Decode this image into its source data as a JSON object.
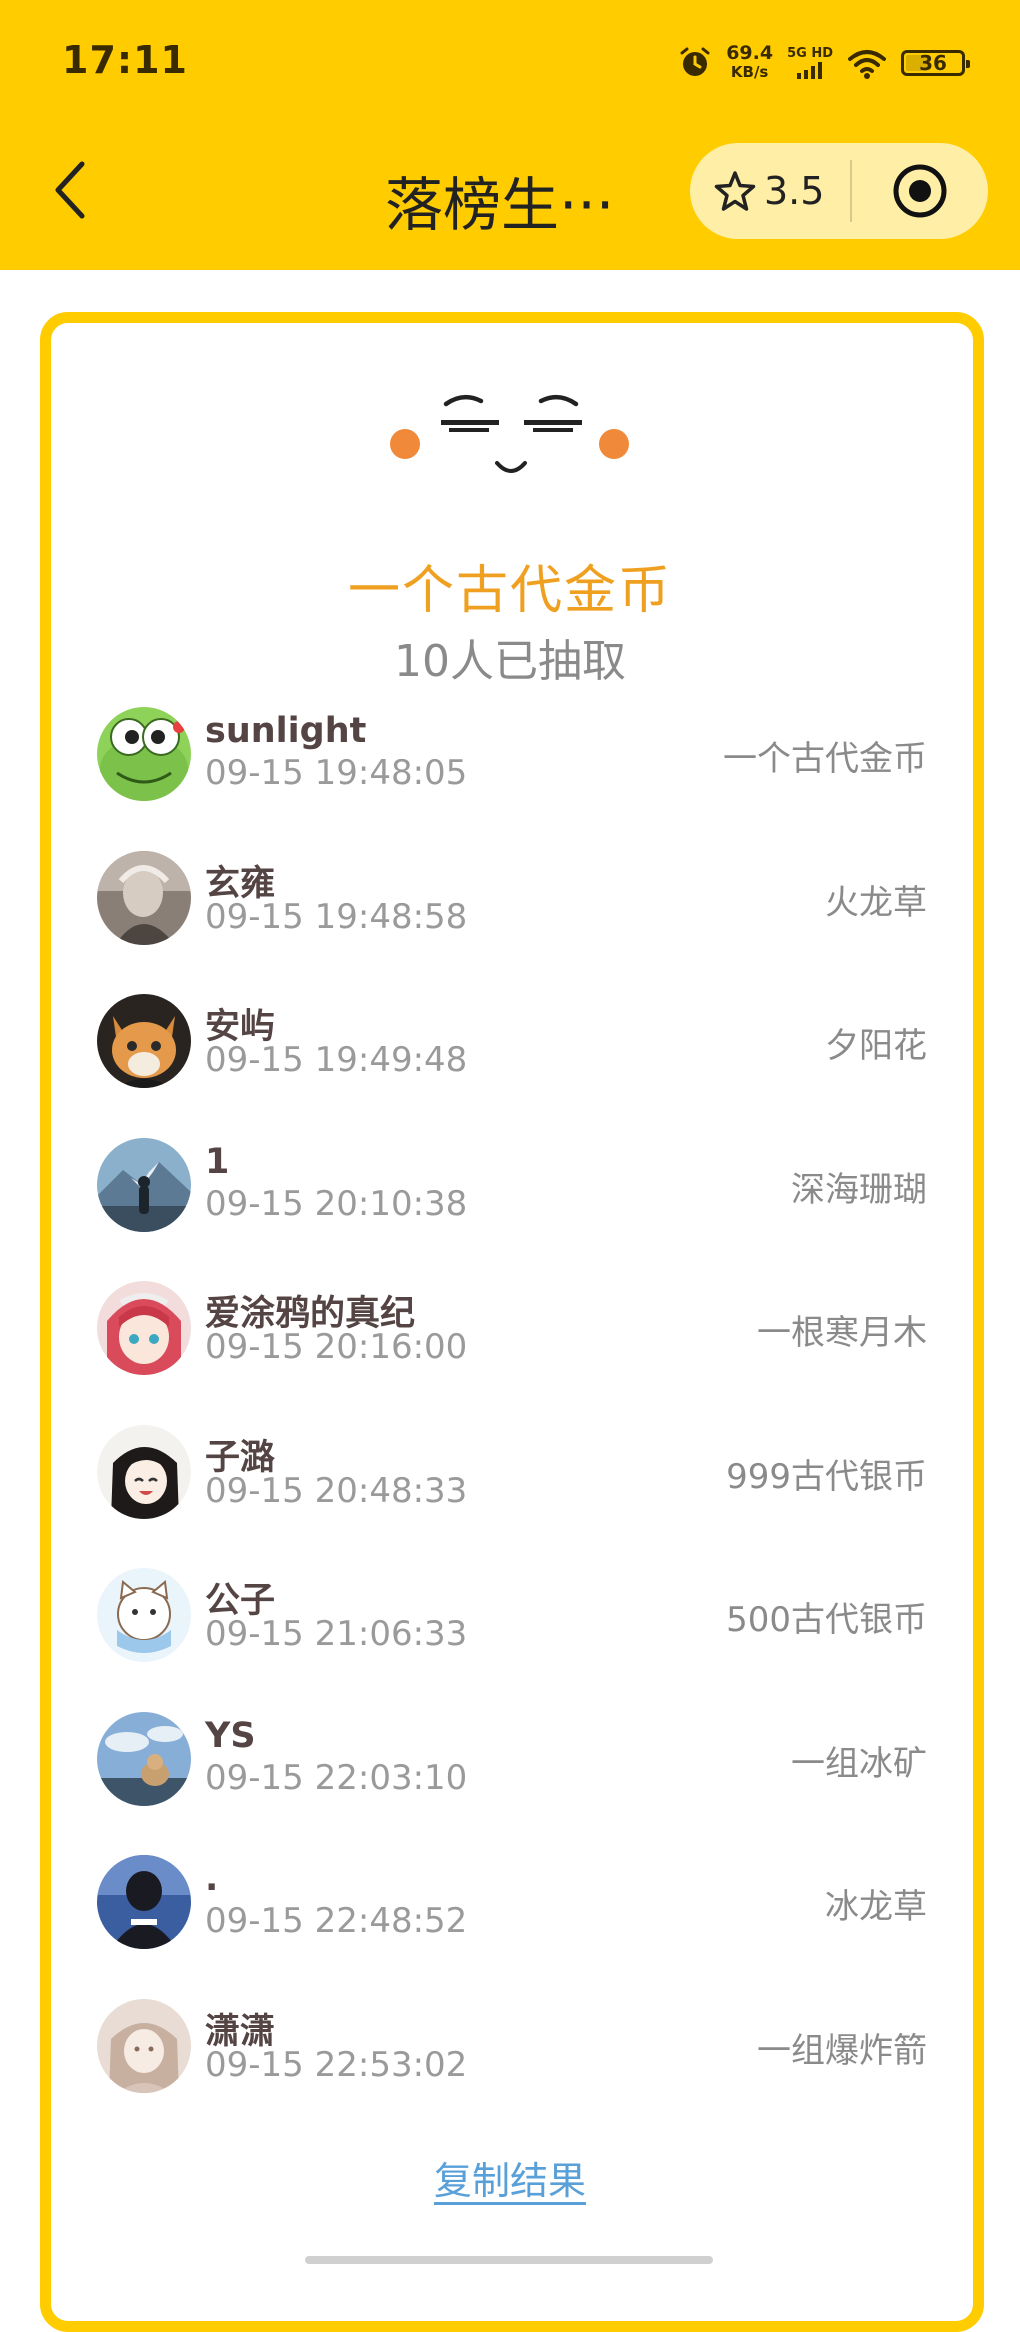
{
  "status_bar": {
    "time": "17:11",
    "speed_value": "69.4",
    "speed_unit": "KB/s",
    "network": "5G HD",
    "battery": "36"
  },
  "nav": {
    "title": "落榜生···",
    "rating": "3.5"
  },
  "result": {
    "prize_name": "一个古代金币",
    "draw_count": "10人已抽取"
  },
  "entries": [
    {
      "name": "sunlight",
      "time": "09-15 19:48:05",
      "prize": "一个古代金币",
      "avatar": "frog"
    },
    {
      "name": "玄雍",
      "time": "09-15 19:48:58",
      "prize": "火龙草",
      "avatar": "sketch-portrait"
    },
    {
      "name": "安屿",
      "time": "09-15 19:49:48",
      "prize": "夕阳花",
      "avatar": "cat"
    },
    {
      "name": "1",
      "time": "09-15 20:10:38",
      "prize": "深海珊瑚",
      "avatar": "mountain-figure"
    },
    {
      "name": "爱涂鸦的真纪",
      "time": "09-15 20:16:00",
      "prize": "一根寒月木",
      "avatar": "anime-red-hair"
    },
    {
      "name": "子潞",
      "time": "09-15 20:48:33",
      "prize": "999古代银币",
      "avatar": "anime-black-hair"
    },
    {
      "name": "公子",
      "time": "09-15 21:06:33",
      "prize": "500古代银币",
      "avatar": "cartoon-cat"
    },
    {
      "name": "YS",
      "time": "09-15 22:03:10",
      "prize": "一组冰矿",
      "avatar": "sky-dog"
    },
    {
      "name": ".",
      "time": "09-15 22:48:52",
      "prize": "冰龙草",
      "avatar": "hooded-person"
    },
    {
      "name": "潇潇",
      "time": "09-15 22:53:02",
      "prize": "一组爆炸箭",
      "avatar": "soft-portrait"
    }
  ],
  "copy_label": "复制结果"
}
